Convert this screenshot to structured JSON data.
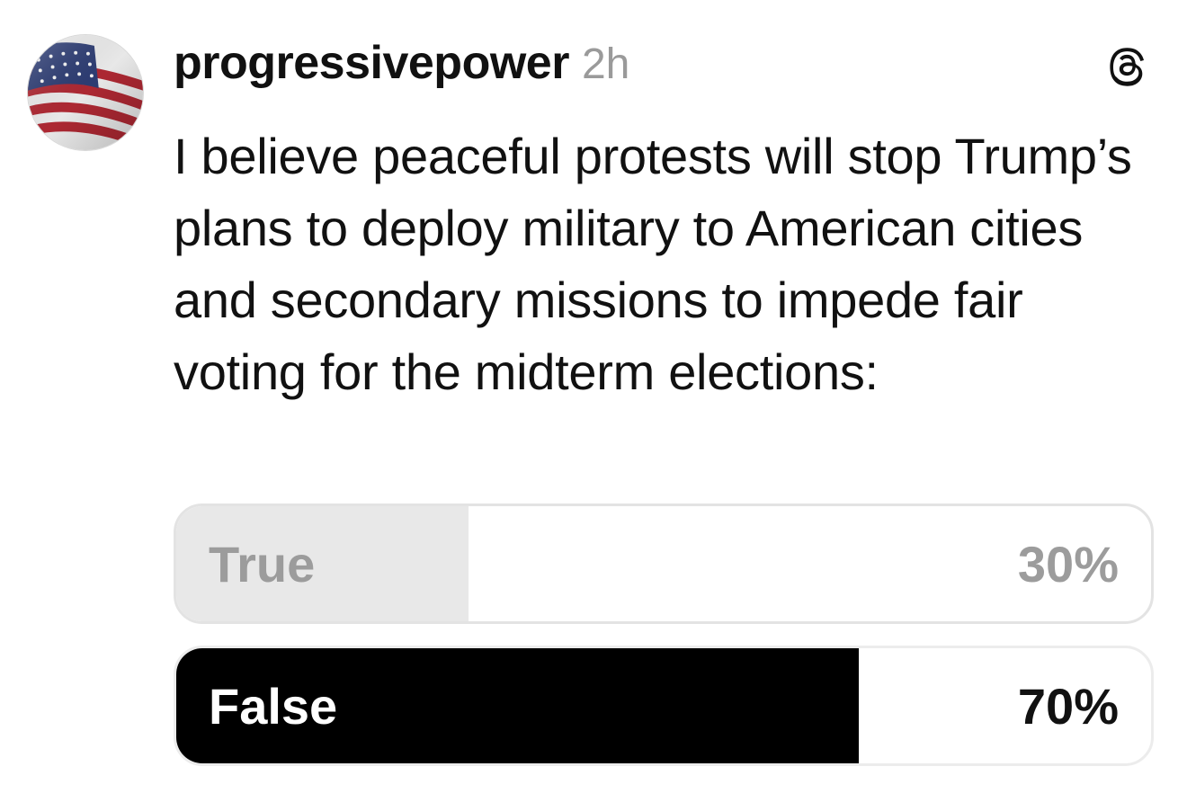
{
  "post": {
    "author": {
      "username": "progressivepower",
      "avatar_icon": "american-flag-avatar"
    },
    "timestamp": "2h",
    "app_icon": "threads-logo-icon",
    "text": "I believe peaceful protests will stop Trump’s plans to deploy military to American cities and secondary missions to impede fair voting for the midterm elections:",
    "poll": {
      "options": [
        {
          "label": "True",
          "percent_text": "30%",
          "fraction": 0.3,
          "selected": false
        },
        {
          "label": "False",
          "percent_text": "70%",
          "fraction": 0.7,
          "selected": true
        }
      ]
    }
  },
  "colors": {
    "text": "#111111",
    "muted": "#9a9a9a",
    "winner_fill": "#000000",
    "loser_fill": "#e8e8e8",
    "border": "#e3e3e3"
  }
}
